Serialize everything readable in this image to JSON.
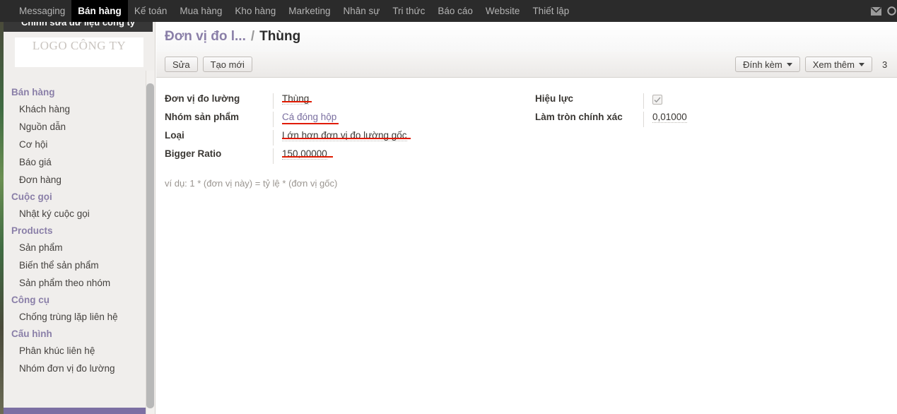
{
  "topbar": {
    "nav": [
      {
        "label": "Messaging",
        "active": false
      },
      {
        "label": "Bán hàng",
        "active": true
      },
      {
        "label": "Kế toán",
        "active": false
      },
      {
        "label": "Mua hàng",
        "active": false
      },
      {
        "label": "Kho hàng",
        "active": false
      },
      {
        "label": "Marketing",
        "active": false
      },
      {
        "label": "Nhân sự",
        "active": false
      },
      {
        "label": "Tri thức",
        "active": false
      },
      {
        "label": "Báo cáo",
        "active": false
      },
      {
        "label": "Website",
        "active": false
      },
      {
        "label": "Thiết lập",
        "active": false
      }
    ],
    "icons": [
      {
        "name": "mail-icon"
      },
      {
        "name": "gear-icon"
      }
    ]
  },
  "sidebar": {
    "tooltip": "Chỉnh sửa dữ liệu công ty",
    "logo_text": "LOGO CÔNG TY",
    "sections": [
      {
        "group": "Bán hàng",
        "items": [
          "Khách hàng",
          "Nguồn dẫn",
          "Cơ hội",
          "Báo giá",
          "Đơn hàng"
        ]
      },
      {
        "group": "Cuộc gọi",
        "items": [
          "Nhật ký cuộc gọi"
        ]
      },
      {
        "group": "Products",
        "items": [
          "Sản phẩm",
          "Biến thể sản phẩm",
          "Sản phẩm theo nhóm"
        ]
      },
      {
        "group": "Công cụ",
        "items": [
          "Chống trùng lặp liên hệ"
        ]
      },
      {
        "group": "Cấu hình",
        "items": [
          "Phân khúc liên hệ",
          "Nhóm đơn vị đo lường"
        ]
      }
    ]
  },
  "breadcrumb": {
    "parent": "Đơn vị đo l...",
    "separator": "/",
    "current": "Thùng"
  },
  "toolbar": {
    "edit_label": "Sửa",
    "create_label": "Tạo mới",
    "attach_label": "Đính kèm",
    "more_label": "Xem thêm",
    "pager": "3"
  },
  "form": {
    "left_fields": [
      {
        "label": "Đơn vị đo lường",
        "value": "Thùng",
        "type": "text",
        "underline_width": 42
      },
      {
        "label": "Nhóm sản phẩm",
        "value": "Cá đóng hộp",
        "type": "link",
        "underline_width": 80
      },
      {
        "label": "Loại",
        "value": "Lớn hơn đơn vị đo lường gốc",
        "type": "text",
        "underline_width": 182
      },
      {
        "label": "Bigger Ratio",
        "value": "150,00000",
        "type": "text",
        "underline_width": 72
      }
    ],
    "right_fields": [
      {
        "label": "Hiệu lực",
        "value": "",
        "type": "checkbox",
        "checked": true
      },
      {
        "label": "Làm tròn chính xác",
        "value": "0,01000",
        "type": "text"
      }
    ],
    "hint": "ví dụ: 1 * (đơn vị này) = tỷ lệ * (đơn vị gốc)"
  },
  "colors": {
    "accent_purple": "#7c6fa3",
    "topbar_bg": "#2b2b2b",
    "sidebar_bg": "#f0eeec",
    "underline_red": "#e01b00"
  }
}
